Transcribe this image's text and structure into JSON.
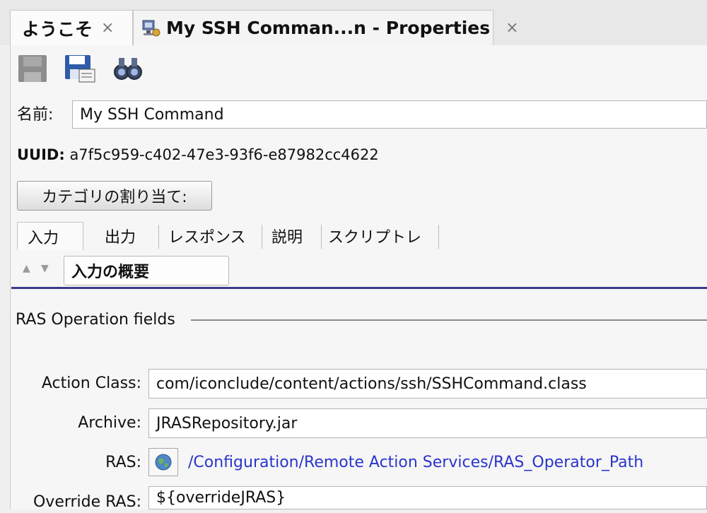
{
  "tabs": [
    {
      "label": "ようこそ",
      "close": "×",
      "active": true
    },
    {
      "label": "My SSH Comman...n - Properties",
      "close": "×",
      "active": false
    }
  ],
  "toolbar": {
    "icons": [
      "save-disabled-icon",
      "save-as-icon",
      "binoculars-icon"
    ]
  },
  "name_row": {
    "label": "名前:",
    "value": "My SSH Command"
  },
  "uuid": {
    "label": "UUID:",
    "value": "a7f5c959-c402-47e3-93f6-e87982cc4622"
  },
  "category_button": "カテゴリの割り当て:",
  "subtabs": [
    "入力",
    "出力",
    "レスポンス",
    "説明",
    "スクリプトレ"
  ],
  "input_summary": {
    "label": "入力の概要"
  },
  "group": {
    "title": "RAS Operation fields"
  },
  "fields": {
    "action_class": {
      "label": "Action Class:",
      "value": "com/iconclude/content/actions/ssh/SSHCommand.class"
    },
    "archive": {
      "label": "Archive:",
      "value": "JRASRepository.jar"
    },
    "ras": {
      "label": "RAS:",
      "value": "/Configuration/Remote Action Services/RAS_Operator_Path",
      "icon": "globe-icon"
    },
    "override_ras": {
      "label": "Override RAS:",
      "value": "${overrideJRAS}"
    }
  },
  "colors": {
    "accent_rule": "#3c3c8c",
    "link": "#2a35c9"
  }
}
